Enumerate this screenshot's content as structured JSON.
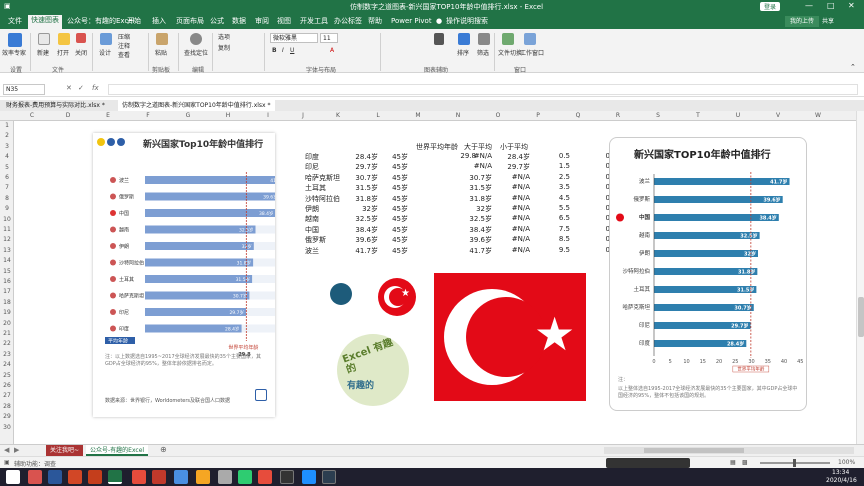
{
  "window": {
    "title": "仿制数字之道图表-新兴国家TOP10年龄中值排行.xlsx - Excel",
    "login": "登录",
    "share": "共享",
    "upload": "我的上传"
  },
  "ribbon_tabs": [
    "文件",
    "快速图表",
    "公众号：有趣的Excel",
    "开始",
    "插入",
    "页面布局",
    "公式",
    "数据",
    "审阅",
    "视图",
    "开发工具",
    "办公标签",
    "帮助",
    "Power Pivot",
    "操作说明搜索"
  ],
  "ribbon": {
    "buttons": [
      "效率专家",
      "新建",
      "打开",
      "关闭",
      "设计",
      "压缩",
      "注释",
      "查看",
      "粘贴",
      "剪贴板",
      "查找定位",
      "编辑",
      "选项",
      "复制",
      "排序",
      "筛选",
      "文件切换",
      "工作窗口",
      "切换",
      "更多"
    ],
    "font_name": "微软雅黑",
    "font_size": "11",
    "groups": [
      "设置",
      "文件",
      "",
      "剪贴板",
      "编辑",
      "",
      "字体与布局",
      "",
      "图表辅助",
      "",
      "窗口"
    ]
  },
  "formula": {
    "namebox": "N35",
    "fx": "fx"
  },
  "doc_tabs": [
    "财务报表-费用预算与实际对比.xlsx *",
    "仿制数字之道图表-新兴国家TOP10年龄中值排行.xlsx *"
  ],
  "columns": [
    "C",
    "D",
    "E",
    "F",
    "G",
    "H",
    "I",
    "J",
    "K",
    "L",
    "M",
    "N",
    "O",
    "P",
    "Q",
    "R",
    "S",
    "T",
    "U",
    "V",
    "W"
  ],
  "rows": [
    "1",
    "2",
    "3",
    "4",
    "5",
    "6",
    "7",
    "8",
    "9",
    "10",
    "11",
    "12",
    "13",
    "14",
    "15",
    "16",
    "17",
    "18",
    "19",
    "20",
    "21",
    "22",
    "23",
    "24",
    "25",
    "26",
    "27",
    "28",
    "29",
    "30"
  ],
  "table": {
    "headers": [
      "世界平均年龄",
      "大于平均",
      "小于平均"
    ],
    "world_avg": "29.8",
    "rows": [
      [
        "印度",
        "28.4岁",
        "45岁",
        "",
        "#N/A",
        "28.4岁",
        "0.5",
        "0"
      ],
      [
        "印尼",
        "29.7岁",
        "45岁",
        "",
        "#N/A",
        "29.7岁",
        "1.5",
        "0"
      ],
      [
        "哈萨克斯坦",
        "30.7岁",
        "45岁",
        "",
        "30.7岁",
        "#N/A",
        "2.5",
        "0"
      ],
      [
        "土耳其",
        "31.5岁",
        "45岁",
        "",
        "31.5岁",
        "#N/A",
        "3.5",
        "0"
      ],
      [
        "沙特阿拉伯",
        "31.8岁",
        "45岁",
        "",
        "31.8岁",
        "#N/A",
        "4.5",
        "0"
      ],
      [
        "伊朗",
        "32岁",
        "45岁",
        "",
        "32岁",
        "#N/A",
        "5.5",
        "0"
      ],
      [
        "越南",
        "32.5岁",
        "45岁",
        "",
        "32.5岁",
        "#N/A",
        "6.5",
        "0"
      ],
      [
        "中国",
        "38.4岁",
        "45岁",
        "",
        "38.4岁",
        "#N/A",
        "7.5",
        "0"
      ],
      [
        "俄罗斯",
        "39.6岁",
        "45岁",
        "",
        "39.6岁",
        "#N/A",
        "8.5",
        "0"
      ],
      [
        "波兰",
        "41.7岁",
        "45岁",
        "",
        "41.7岁",
        "#N/A",
        "9.5",
        "0"
      ]
    ]
  },
  "left_panel": {
    "title": "新兴国家Top10年龄中值排行",
    "countries": [
      "波兰",
      "俄罗斯",
      "中国",
      "越南",
      "伊朗",
      "沙特阿拉伯",
      "土耳其",
      "哈萨克斯坦",
      "印尼",
      "印度"
    ],
    "labels": [
      "41.7岁",
      "39.6岁",
      "38.4岁",
      "32.5岁",
      "32岁",
      "31.8岁",
      "31.5岁",
      "30.7岁",
      "29.7岁",
      "28.4岁"
    ],
    "avg_tag": "平均年龄",
    "avg_note": "世界平均年龄",
    "avg_value": "29.8",
    "footer": "数据来源：世界银行，Worldometers及联合国人口数据",
    "note": "注：以上数据选自1995~2017全球经济发展最快的35个主要国家，其GDP占全球经济的95%，整体年龄依据排名而定。"
  },
  "right_panel": {
    "title": "新兴国家TOP10年龄中值排行",
    "countries": [
      "波兰",
      "俄罗斯",
      "中国",
      "越南",
      "伊朗",
      "沙特阿拉伯",
      "土耳其",
      "哈萨克斯坦",
      "印尼",
      "印度"
    ],
    "values": [
      41.7,
      39.6,
      38.4,
      32.5,
      32,
      31.8,
      31.5,
      30.7,
      29.7,
      28.4
    ],
    "labels": [
      "41.7岁",
      "39.6岁",
      "38.4岁",
      "32.5岁",
      "32岁",
      "31.8岁",
      "31.5岁",
      "30.7岁",
      "29.7岁",
      "28.4岁"
    ],
    "ticks": [
      "0",
      "5",
      "10",
      "15",
      "20",
      "25",
      "30",
      "35",
      "40",
      "45"
    ],
    "avg_label": "世界平均年龄",
    "avg_value": "29.8",
    "note_head": "注：",
    "note": "以上整体选自1995-2017全球经济发展最快的35个主要国家，其中GDP占全球中国经济的95%，整体不包括该国的规划。"
  },
  "shapes": {
    "wordcloud_text": "Excel 有趣的"
  },
  "sheet_tabs": [
    "关注我吧~",
    "公众号-有趣的Excel"
  ],
  "status": {
    "left": "辅助功能：调查",
    "zoom": "100%"
  },
  "clock": {
    "time": "13:34",
    "date": "2020/4/16"
  },
  "colors": {
    "excel_green": "#217346",
    "bar_blue": "#2e7fae",
    "left_bar": "#7d9ed3",
    "turkey_red": "#e30a17",
    "avg_red": "#c0392b"
  }
}
